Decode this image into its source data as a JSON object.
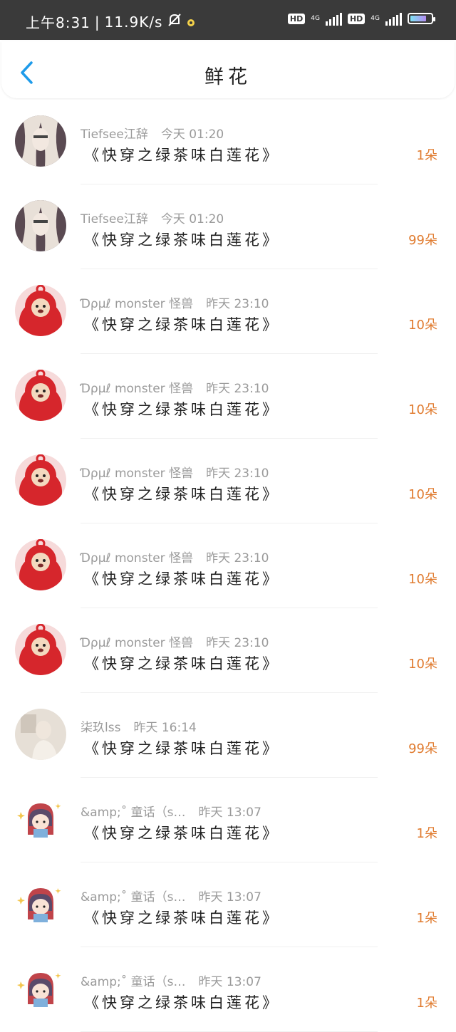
{
  "status_bar": {
    "time": "上午8:31",
    "speed": "11.9K/s",
    "hd1": "HD",
    "net1": "4G",
    "hd2": "HD",
    "net2": "4G",
    "battery_level_percent": 80,
    "icons": [
      "mute-icon",
      "app-notification-icon",
      "signal-icon",
      "battery-icon"
    ]
  },
  "header": {
    "title": "鲜花",
    "back_icon": "chevron-left-icon",
    "accent": "#1e9bea"
  },
  "colors": {
    "amount": "#e07b2f",
    "meta": "#9a9a9a"
  },
  "items": [
    {
      "user": "Tiefsee江辞",
      "time": "今天 01:20",
      "book": "《快穿之绿茶味白莲花》",
      "amount": "1朵",
      "avatar": "anime-girl-avatar"
    },
    {
      "user": "Tiefsee江辞",
      "time": "今天 01:20",
      "book": "《快穿之绿茶味白莲花》",
      "amount": "99朵",
      "avatar": "anime-girl-avatar"
    },
    {
      "user": "Ɗρμℓ monster 怪兽",
      "time": "昨天 23:10",
      "book": "《快穿之绿茶味白莲花》",
      "amount": "10朵",
      "avatar": "red-teletubby-avatar"
    },
    {
      "user": "Ɗρμℓ monster 怪兽",
      "time": "昨天 23:10",
      "book": "《快穿之绿茶味白莲花》",
      "amount": "10朵",
      "avatar": "red-teletubby-avatar"
    },
    {
      "user": "Ɗρμℓ monster 怪兽",
      "time": "昨天 23:10",
      "book": "《快穿之绿茶味白莲花》",
      "amount": "10朵",
      "avatar": "red-teletubby-avatar"
    },
    {
      "user": "Ɗρμℓ monster 怪兽",
      "time": "昨天 23:10",
      "book": "《快穿之绿茶味白莲花》",
      "amount": "10朵",
      "avatar": "red-teletubby-avatar"
    },
    {
      "user": "Ɗρμℓ monster 怪兽",
      "time": "昨天 23:10",
      "book": "《快穿之绿茶味白莲花》",
      "amount": "10朵",
      "avatar": "red-teletubby-avatar"
    },
    {
      "user": "柒玖lss",
      "time": "昨天 16:14",
      "book": "《快穿之绿茶味白莲花》",
      "amount": "99朵",
      "avatar": "photo-avatar"
    },
    {
      "user": "&amp;˚ 童话（s…",
      "time": "昨天 13:07",
      "book": "《快穿之绿茶味白莲花》",
      "amount": "1朵",
      "avatar": "cartoon-girl-avatar"
    },
    {
      "user": "&amp;˚ 童话（s…",
      "time": "昨天 13:07",
      "book": "《快穿之绿茶味白莲花》",
      "amount": "1朵",
      "avatar": "cartoon-girl-avatar"
    },
    {
      "user": "&amp;˚ 童话（s…",
      "time": "昨天 13:07",
      "book": "《快穿之绿茶味白莲花》",
      "amount": "1朵",
      "avatar": "cartoon-girl-avatar"
    }
  ]
}
